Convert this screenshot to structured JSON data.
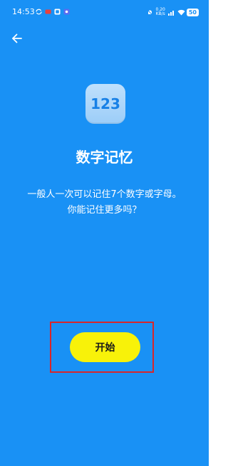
{
  "status_bar": {
    "time": "14:53",
    "net_speed_value": "0.20",
    "net_speed_unit": "KB/s",
    "battery": "50"
  },
  "logo": {
    "text": "123"
  },
  "page": {
    "title": "数字记忆",
    "description_line1": "一般人一次可以记住7个数字或字母。",
    "description_line2": "你能记住更多吗？"
  },
  "actions": {
    "start_label": "开始"
  },
  "colors": {
    "background": "#1991f5",
    "start_button": "#f8f209",
    "highlight_border": "#d8262a"
  }
}
